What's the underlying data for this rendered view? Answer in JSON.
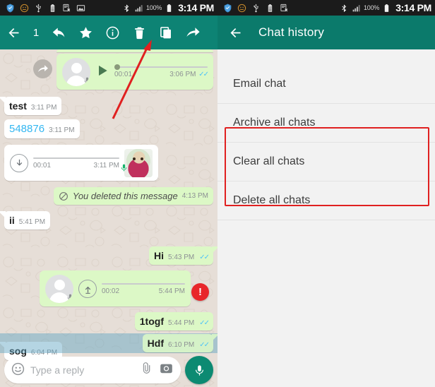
{
  "status_bar": {
    "left_icons": [
      "shield-icon",
      "smiley-icon",
      "usb-icon",
      "battery-saver-icon",
      "screenshot-icon",
      "image-icon"
    ],
    "left_icons_right_panel": [
      "shield-icon",
      "smiley-icon",
      "usb-icon",
      "battery-saver-icon",
      "screenshot-icon"
    ],
    "bluetooth_icon": "bluetooth-icon",
    "signal_icon": "signal-bars-icon",
    "battery_percent": "100%",
    "battery_icon": "battery-icon",
    "time": "3:14 PM"
  },
  "left_panel": {
    "toolbar": {
      "back_icon": "back-arrow-icon",
      "selected_count": "1",
      "reply_icon": "reply-icon",
      "star_icon": "star-icon",
      "info_icon": "info-icon",
      "delete_icon": "trash-icon",
      "copy_icon": "copy-icon",
      "forward_icon": "forward-icon"
    },
    "messages": [
      {
        "id": "m0",
        "type": "partial-bubble",
        "direction": "out"
      },
      {
        "id": "m1",
        "type": "audio",
        "direction": "out",
        "forwarded": true,
        "state": "play",
        "duration": "00:01",
        "time": "3:06 PM",
        "ticks": "read"
      },
      {
        "id": "m2",
        "type": "text",
        "direction": "in",
        "text": "test",
        "time": "3:11 PM"
      },
      {
        "id": "m3",
        "type": "text",
        "direction": "in",
        "text": "548876",
        "style": "link",
        "time": "3:11 PM"
      },
      {
        "id": "m4",
        "type": "audio",
        "direction": "in",
        "state": "download",
        "duration": "00:01",
        "time": "3:11 PM",
        "thumbnail": "dog-photo-thumbnail"
      },
      {
        "id": "m5",
        "type": "deleted",
        "direction": "out",
        "icon": "blocked-icon",
        "text": "You deleted this message",
        "time": "4:13 PM"
      },
      {
        "id": "m6",
        "type": "text",
        "direction": "in",
        "text": "ii",
        "time": "5:41 PM"
      },
      {
        "id": "m7",
        "type": "text",
        "direction": "out",
        "text": "Hi",
        "time": "5:43 PM",
        "ticks": "read"
      },
      {
        "id": "m8",
        "type": "audio",
        "direction": "out",
        "state": "upload",
        "duration": "00:02",
        "time": "5:44 PM",
        "error": true,
        "error_icon": "error-exclamation-icon"
      },
      {
        "id": "m9",
        "type": "text",
        "direction": "out",
        "text": "1togf",
        "time": "5:44 PM",
        "ticks": "read"
      },
      {
        "id": "m10",
        "type": "text",
        "direction": "in",
        "text": "sog",
        "time": "6:04 PM"
      },
      {
        "id": "m11",
        "type": "text",
        "direction": "out",
        "text": "Hdf",
        "time": "6:10 PM",
        "ticks": "read",
        "selected": true
      }
    ],
    "composer": {
      "emoji_icon": "emoji-icon",
      "placeholder": "Type a reply",
      "attach_icon": "paperclip-icon",
      "camera_icon": "camera-icon",
      "mic_icon": "microphone-icon"
    },
    "annotation": {
      "type": "arrow",
      "color": "#e02020",
      "points_to": "trash-icon"
    }
  },
  "right_panel": {
    "toolbar": {
      "back_icon": "back-arrow-icon",
      "title": "Chat history"
    },
    "menu_items": [
      {
        "label": "Email chat",
        "highlighted": false
      },
      {
        "label": "Archive all chats",
        "highlighted": false
      },
      {
        "label": "Clear all chats",
        "highlighted": true
      },
      {
        "label": "Delete all chats",
        "highlighted": true
      }
    ],
    "highlight_color": "#e02020"
  },
  "colors": {
    "app_bar": "#0d8374",
    "app_bar_dark": "#0b7a6b",
    "status_bar": "#1b1b1b",
    "outgoing_bubble": "#dcf8c6",
    "incoming_bubble": "#ffffff",
    "chat_background": "#e6ded7",
    "menu_background": "#f2f2f2",
    "tick_blue": "#4fc3f7",
    "link_blue": "#34b7f1",
    "accent_red": "#e02020",
    "selection_blue": "#5ba1c1"
  }
}
